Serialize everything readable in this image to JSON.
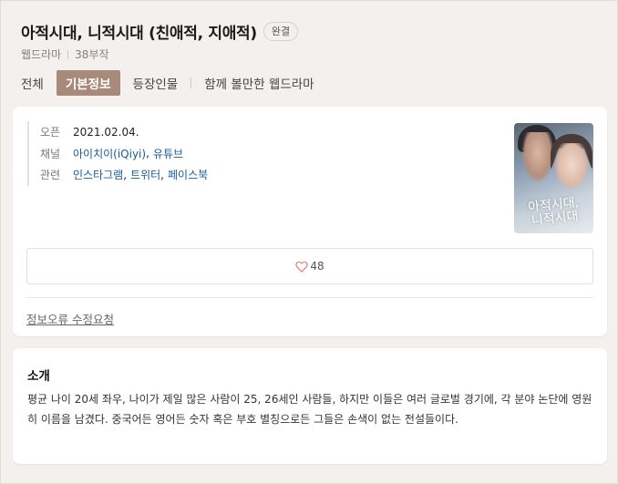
{
  "header": {
    "title": "아적시대, 니적시대 (친애적, 지애적)",
    "status_badge": "완결",
    "genre": "웹드라마",
    "episodes": "38부작"
  },
  "tabs": [
    {
      "label": "전체",
      "active": false
    },
    {
      "label": "기본정보",
      "active": true
    },
    {
      "label": "등장인물",
      "active": false
    },
    {
      "label": "함께 볼만한 웹드라마",
      "active": false
    }
  ],
  "info": {
    "open_label": "오픈",
    "open_value": "2021.02.04.",
    "channel_label": "채널",
    "channels": [
      "아이치이(iQiyi)",
      "유튜브"
    ],
    "related_label": "관련",
    "related": [
      "인스타그램",
      "트위터",
      "페이스북"
    ]
  },
  "poster": {
    "title_line1": "아적시대,",
    "title_line2": "니적시대"
  },
  "like": {
    "icon": "heart-icon",
    "count": "48"
  },
  "report_link": "정보오류 수정요청",
  "intro": {
    "heading": "소개",
    "body": "평균 나이 20세 좌우, 나이가 제일 많은 사람이 25, 26세인 사람들, 하지만 이들은 여러 글로벌 경기에, 각 분야 논단에 영원히 이름을 남겼다. 중국어든 영어든 숫자 혹은 부호 별칭으로든 그들은 손색이 없는 전설들이다."
  },
  "colors": {
    "active_tab_bg": "#a98979",
    "link": "#1a5a9a",
    "page_bg": "#f4f0ee"
  }
}
